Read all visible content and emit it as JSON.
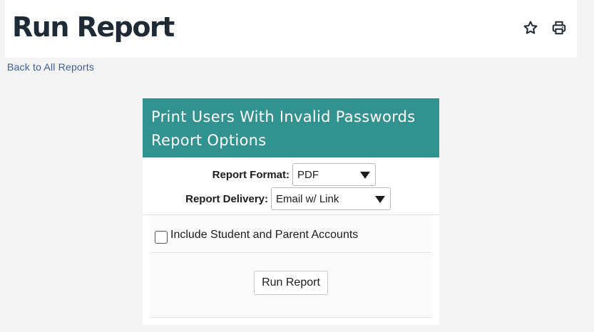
{
  "page": {
    "title": "Run Report",
    "back_link": "Back to All Reports"
  },
  "toolbar": {
    "favorite_icon": "star-icon",
    "print_icon": "printer-icon"
  },
  "report_options": {
    "heading": "Print Users With Invalid Passwords Report Options",
    "format_label": "Report Format:",
    "format_value": "PDF",
    "delivery_label": "Report Delivery:",
    "delivery_value": "Email w/ Link",
    "include_accounts_label": "Include Student and Parent Accounts",
    "include_accounts_checked": false,
    "run_button_label": "Run Report"
  },
  "colors": {
    "panel_header": "#31928f",
    "link": "#3b5b9a",
    "title": "#1f2a37",
    "background": "#f4f4f4"
  }
}
